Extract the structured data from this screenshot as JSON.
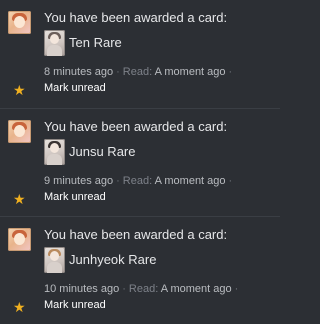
{
  "notifications": [
    {
      "title": "You have been awarded a card:",
      "card_name": "Ten Rare",
      "time": "8 minutes ago",
      "read_label": "Read:",
      "read_value": "A moment ago",
      "action": "Mark unread",
      "icon": "star-icon"
    },
    {
      "title": "You have been awarded a card:",
      "card_name": "Junsu Rare",
      "time": "9 minutes ago",
      "read_label": "Read:",
      "read_value": "A moment ago",
      "action": "Mark unread",
      "icon": "star-icon"
    },
    {
      "title": "You have been awarded a card:",
      "card_name": "Junhyeok Rare",
      "time": "10 minutes ago",
      "read_label": "Read:",
      "read_value": "A moment ago",
      "action": "Mark unread",
      "icon": "star-icon"
    }
  ],
  "colors": {
    "background": "#2c2f34",
    "text": "#e6e7e9",
    "muted_text": "#b9bcc0",
    "star": "#f0b020"
  },
  "separator_glyph": "·"
}
